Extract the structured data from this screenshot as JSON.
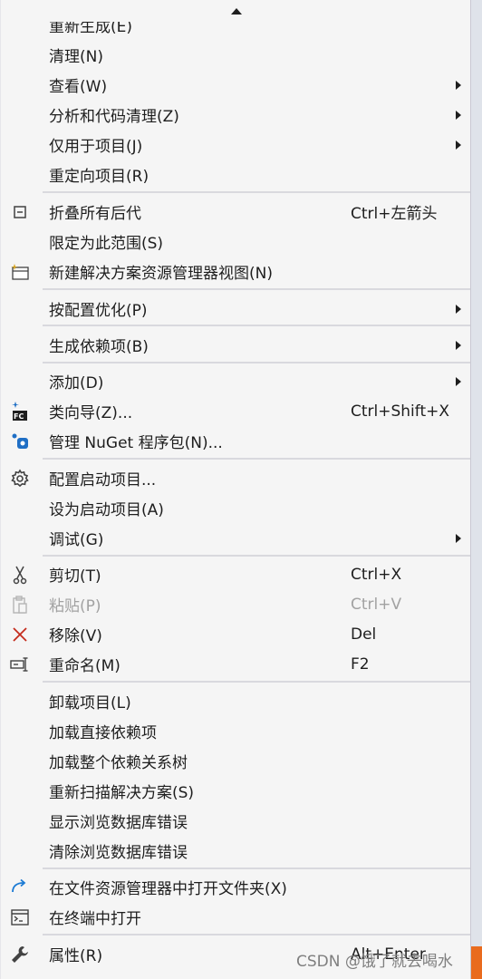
{
  "menu": {
    "items": [
      {
        "label": "重新生成(E)"
      },
      {
        "label": "清理(N)"
      },
      {
        "label": "查看(W)"
      },
      {
        "label": "分析和代码清理(Z)"
      },
      {
        "label": "仅用于项目(J)"
      },
      {
        "label": "重定向项目(R)"
      },
      {
        "label": "折叠所有后代",
        "shortcut": "Ctrl+左箭头",
        "icon": "collapse-icon"
      },
      {
        "label": "限定为此范围(S)"
      },
      {
        "label": "新建解决方案资源管理器视图(N)",
        "icon": "new-explorer-view-icon"
      },
      {
        "label": "按配置优化(P)"
      },
      {
        "label": "生成依赖项(B)"
      },
      {
        "label": "添加(D)"
      },
      {
        "label": "类向导(Z)...",
        "shortcut": "Ctrl+Shift+X",
        "icon": "class-wizard-icon"
      },
      {
        "label": "管理 NuGet 程序包(N)...",
        "icon": "nuget-icon"
      },
      {
        "label": "配置启动项目...",
        "icon": "gear-icon"
      },
      {
        "label": "设为启动项目(A)"
      },
      {
        "label": "调试(G)"
      },
      {
        "label": "剪切(T)",
        "shortcut": "Ctrl+X",
        "icon": "scissors-icon"
      },
      {
        "label": "粘贴(P)",
        "shortcut": "Ctrl+V",
        "icon": "paste-icon"
      },
      {
        "label": "移除(V)",
        "shortcut": "Del",
        "icon": "remove-icon"
      },
      {
        "label": "重命名(M)",
        "shortcut": "F2",
        "icon": "rename-icon"
      },
      {
        "label": "卸载项目(L)"
      },
      {
        "label": "加载直接依赖项"
      },
      {
        "label": "加载整个依赖关系树"
      },
      {
        "label": "重新扫描解决方案(S)"
      },
      {
        "label": "显示浏览数据库错误"
      },
      {
        "label": "清除浏览数据库错误"
      },
      {
        "label": "在文件资源管理器中打开文件夹(X)",
        "icon": "open-folder-icon"
      },
      {
        "label": "在终端中打开",
        "icon": "terminal-icon"
      },
      {
        "label": "属性(R)",
        "shortcut": "Alt+Enter",
        "icon": "wrench-icon"
      }
    ]
  },
  "watermark": "CSDN @饿了就去喝水",
  "colors": {
    "remove_icon": "#c42b1c",
    "nuget_icon": "#1f6fc5",
    "redo_icon": "#1c7bd4"
  }
}
